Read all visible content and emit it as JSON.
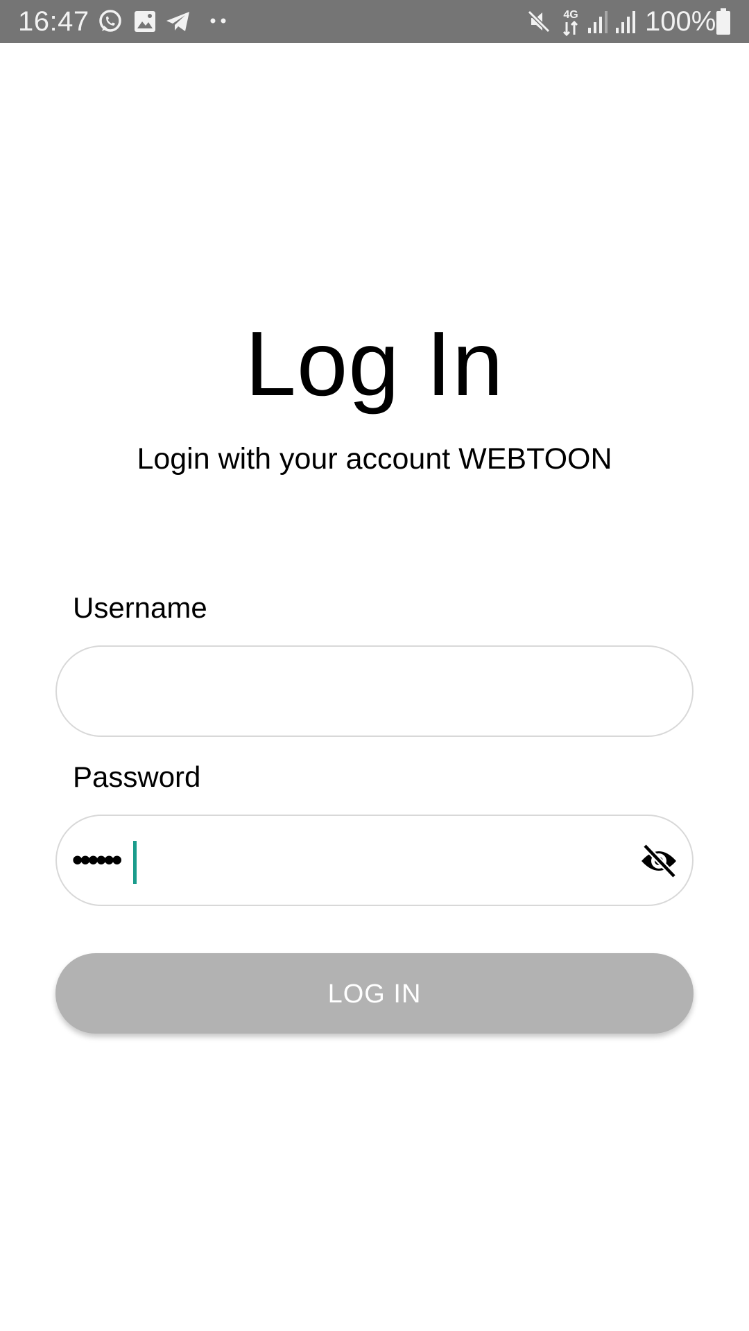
{
  "status_bar": {
    "time": "16:47",
    "battery": "100%",
    "icons": [
      "whatsapp-icon",
      "gallery-icon",
      "telegram-icon",
      "more-notifications-icon",
      "mute-icon",
      "4g-icon",
      "signal-icon",
      "signal-icon-2",
      "battery-icon"
    ]
  },
  "login": {
    "title": "Log In",
    "subtitle": "Login with your account WEBTOON",
    "username_label": "Username",
    "username_value": "",
    "password_label": "Password",
    "password_value": "••••••",
    "visibility_icon": "eye-off-icon",
    "button_label": "LOG IN"
  },
  "colors": {
    "status_bar_bg": "#757575",
    "caret": "#1a9c8c",
    "button_disabled": "#b2b2b2",
    "field_border": "#d8d8d8"
  }
}
